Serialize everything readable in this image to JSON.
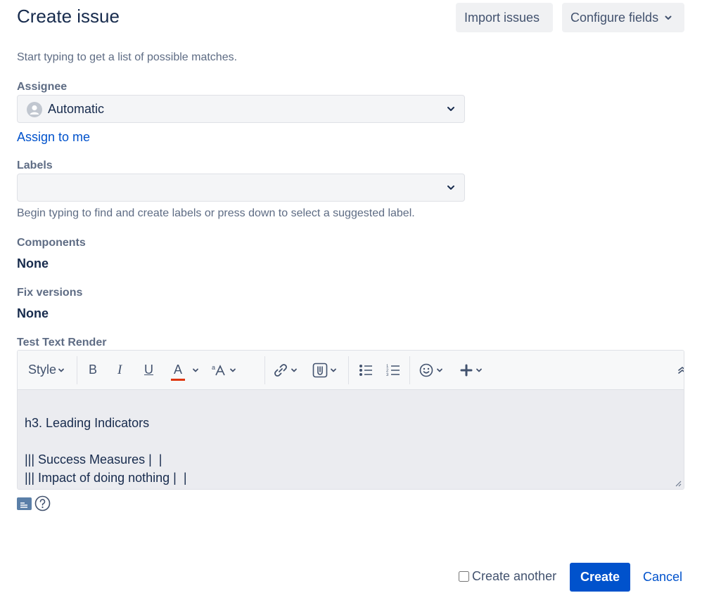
{
  "header": {
    "title": "Create issue",
    "import_label": "Import issues",
    "configure_label": "Configure fields"
  },
  "hint_top": "Start typing to get a list of possible matches.",
  "assignee": {
    "label": "Assignee",
    "value": "Automatic",
    "assign_to_me": "Assign to me"
  },
  "labels": {
    "label": "Labels",
    "value": "",
    "hint": "Begin typing to find and create labels or press down to select a suggested label."
  },
  "components": {
    "label": "Components",
    "value": "None"
  },
  "fix_versions": {
    "label": "Fix versions",
    "value": "None"
  },
  "test_text_render": {
    "label": "Test Text Render",
    "toolbar": {
      "style_label": "Style",
      "bold": "B",
      "italic": "I",
      "underline": "U",
      "text_color": "A",
      "text_color_underline": "#de350b"
    },
    "lines": [
      "h3. Leading Indicators",
      "",
      "||| Success Measures |  |",
      "||| Impact of doing nothing |  |"
    ]
  },
  "footer": {
    "create_another": "Create another",
    "create_another_checked": false,
    "create": "Create",
    "cancel": "Cancel"
  },
  "colors": {
    "primary": "#0052cc",
    "text": "#172b4d",
    "muted": "#5e6c84"
  }
}
